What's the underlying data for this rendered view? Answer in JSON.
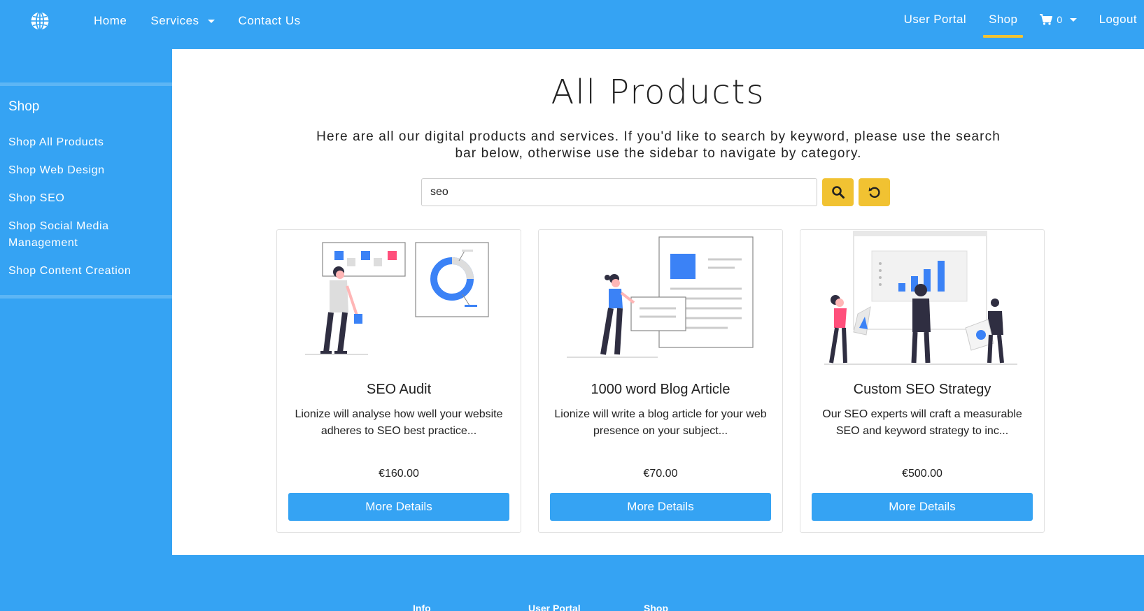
{
  "nav": {
    "left": [
      {
        "label": "Home",
        "dropdown": false
      },
      {
        "label": "Services",
        "dropdown": true
      },
      {
        "label": "Contact Us",
        "dropdown": false
      }
    ],
    "right": {
      "user_portal": "User Portal",
      "shop": "Shop",
      "cart_count": "0",
      "logout": "Logout"
    },
    "active_color": "#f1c232"
  },
  "sidebar": {
    "title": "Shop",
    "links": [
      "Shop All Products",
      "Shop Web Design",
      "Shop SEO",
      "Shop Social Media Management",
      "Shop Content Creation"
    ]
  },
  "main": {
    "title": "All Products",
    "intro": "Here are all our digital products and services. If you'd like to search by keyword, please use the search bar below, otherwise use the sidebar to navigate by category.",
    "search": {
      "value": "seo",
      "placeholder": ""
    },
    "products": [
      {
        "title": "SEO Audit",
        "desc": "Lionize will analyse how well your website adheres to SEO best practice...",
        "price": "€160.00",
        "button": "More Details",
        "illustration": "seo-audit-illustration"
      },
      {
        "title": "1000 word Blog Article",
        "desc": "Lionize will write a blog article for your web presence on your subject...",
        "price": "€70.00",
        "button": "More Details",
        "illustration": "blog-article-illustration"
      },
      {
        "title": "Custom SEO Strategy",
        "desc": "Our SEO experts will craft a measurable SEO and keyword strategy to inc...",
        "price": "€500.00",
        "button": "More Details",
        "illustration": "seo-strategy-illustration"
      }
    ]
  },
  "footer": {
    "columns": [
      "Info",
      "User Portal",
      "Shop"
    ]
  },
  "colors": {
    "brand": "#35a3f3",
    "accent": "#f1c232"
  }
}
